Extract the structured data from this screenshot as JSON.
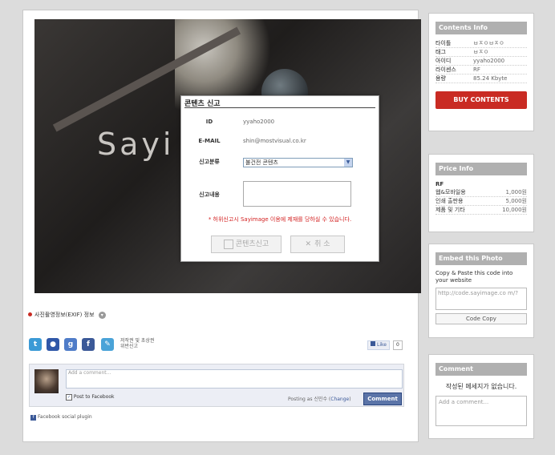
{
  "photo": {
    "watermark": "Sayi"
  },
  "contents_info": {
    "title": "Contents Info",
    "rows": [
      {
        "k": "타이틀",
        "v": "ㅂㅈㅇㅂㅈㅇ"
      },
      {
        "k": "태그",
        "v": "ㅂㅈㅇ"
      },
      {
        "k": "아이디",
        "v": "yyaho2000"
      },
      {
        "k": "라이센스",
        "v": "RF"
      },
      {
        "k": "용량",
        "v": "85.24 Kbyte"
      }
    ],
    "buy_label": "BUY CONTENTS"
  },
  "price_info": {
    "title": "Price Info",
    "license": "RF",
    "rows": [
      {
        "k": "웹&모바일용",
        "v": "1,000원"
      },
      {
        "k": "인쇄 출판용",
        "v": "5,000원"
      },
      {
        "k": "제품 및 기타",
        "v": "10,000원"
      }
    ]
  },
  "embed": {
    "title": "Embed this Photo",
    "desc": "Copy & Paste this code into your website",
    "code": "http://code.sayimage.co m/?",
    "copy_label": "Code Copy"
  },
  "comment_side": {
    "title": "Comment",
    "empty_text": "작성된 메세지가 없습니다.",
    "placeholder": "Add a comment..."
  },
  "modal": {
    "title": "콘텐츠 신고",
    "id_label": "ID",
    "id_value": "yyaho2000",
    "email_label": "E-MAIL",
    "email_value": "shin@mostvisual.co.kr",
    "category_label": "신고분류",
    "category_value": "불건전 콘텐츠",
    "content_label": "신고내용",
    "warning": "* 허위신고시 Sayimage 이용에 제재를 당하실 수 있습니다.",
    "submit_label": "콘텐츠신고",
    "cancel_label": "취 소"
  },
  "exif": {
    "label": "사진촬영정보(EXIF) 정보"
  },
  "share": {
    "report_line1": "저작권 및 초상권",
    "report_line2": "위반신고",
    "like_label": "Like",
    "like_count": "0"
  },
  "fb_comments": {
    "placeholder": "Add a comment...",
    "post_to_fb": "Post to Facebook",
    "posting_as": "Posting as 신민수 (",
    "change": "Change",
    "posting_close": ")",
    "button": "Comment",
    "plugin": "Facebook social plugin"
  }
}
